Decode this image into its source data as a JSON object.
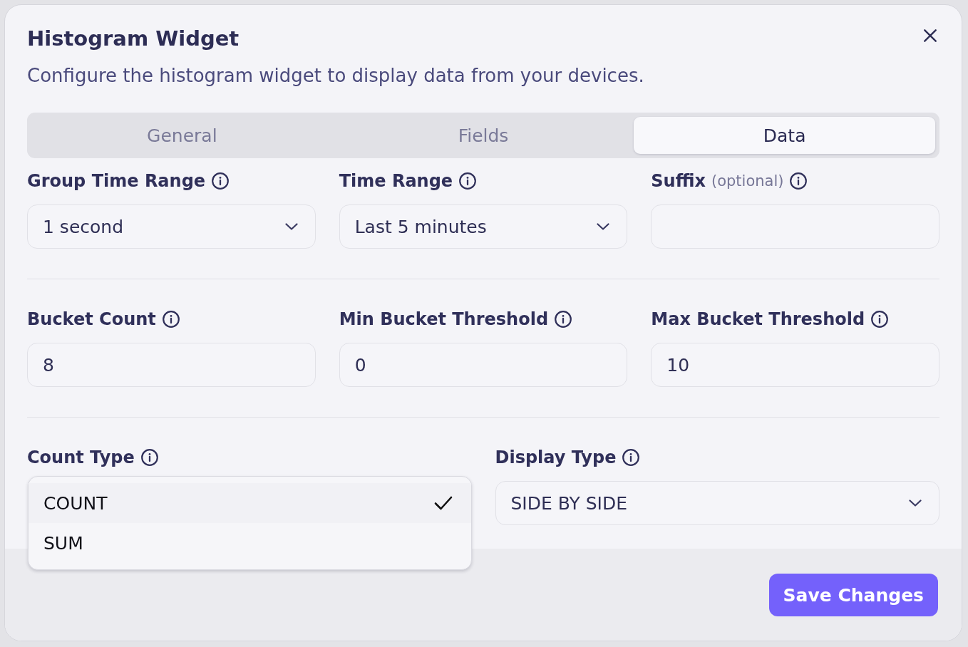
{
  "dialog": {
    "title": "Histogram Widget",
    "description": "Configure the histogram widget to display data from your devices."
  },
  "tabs": [
    {
      "label": "General",
      "selected": false
    },
    {
      "label": "Fields",
      "selected": false
    },
    {
      "label": "Data",
      "selected": true
    }
  ],
  "sections": [
    {
      "fields": [
        {
          "kind": "select",
          "label": "Group Time Range",
          "value": "1 second"
        },
        {
          "kind": "select",
          "label": "Time Range",
          "value": "Last 5 minutes"
        },
        {
          "kind": "text",
          "label": "Suffix",
          "hint": "(optional)"
        }
      ]
    },
    {
      "fields": [
        {
          "kind": "text",
          "label": "Bucket Count",
          "value": "8"
        },
        {
          "kind": "text",
          "label": "Min Bucket Threshold",
          "value": "0"
        },
        {
          "kind": "text",
          "label": "Max Bucket Threshold",
          "value": "10"
        }
      ]
    },
    {
      "fields": [
        {
          "kind": "listbox",
          "label": "Count Type",
          "options": [
            {
              "label": "COUNT",
              "selected": true
            },
            {
              "label": "SUM",
              "selected": false
            }
          ]
        },
        {
          "kind": "select",
          "label": "Display Type",
          "value": "SIDE BY SIDE"
        }
      ]
    }
  ],
  "footer": {
    "save_label": "Save Changes"
  }
}
